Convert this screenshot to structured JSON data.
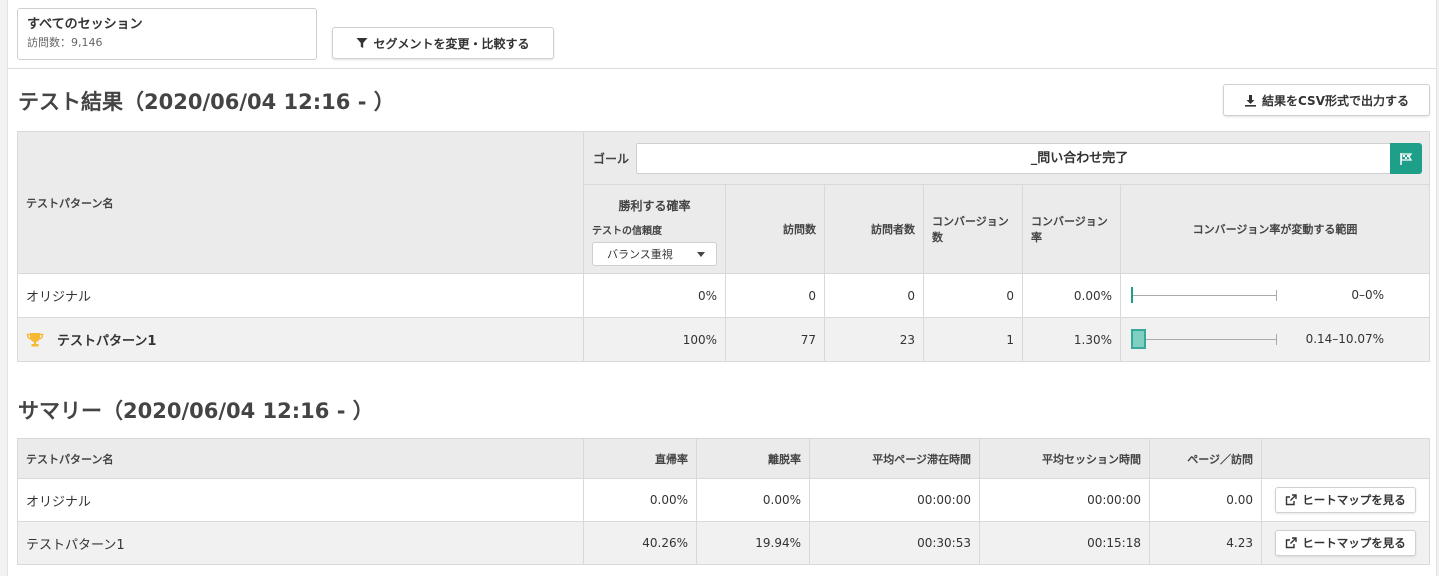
{
  "segment": {
    "title": "すべてのセッション",
    "subtitle": "訪問数：9,146",
    "change_button": "セグメントを変更・比較する"
  },
  "results": {
    "title": "テスト結果（2020/06/04 12:16 - ）",
    "csv_button": "結果をCSV形式で出力する",
    "goal_label": "ゴール",
    "goal_value": "_問い合わせ完了",
    "columns": {
      "pattern_name": "テストパターン名",
      "win_probability": "勝利する確率",
      "confidence_label": "テストの信頼度",
      "confidence_select": "バランス重視",
      "visits": "訪問数",
      "visitors": "訪問者数",
      "conversions": "コンバージョン数",
      "conversion_rate": "コンバージョン率",
      "range": "コンバージョン率が変動する範囲"
    },
    "rows": [
      {
        "name": "オリジナル",
        "win_probability": "0%",
        "visits": "0",
        "visitors": "0",
        "conversions": "0",
        "conversion_rate": "0.00%",
        "range_text": "0–0%",
        "winner": false,
        "range_low": 0,
        "range_high": 0
      },
      {
        "name": "テストパターン1",
        "win_probability": "100%",
        "visits": "77",
        "visitors": "23",
        "conversions": "1",
        "conversion_rate": "1.30%",
        "range_text": "0.14–10.07%",
        "winner": true,
        "range_low": 0.14,
        "range_high": 10.07
      }
    ]
  },
  "summary": {
    "title": "サマリー（2020/06/04 12:16 - ）",
    "columns": {
      "pattern_name": "テストパターン名",
      "bounce_direct": "直帰率",
      "exit_rate": "離脱率",
      "avg_page_time": "平均ページ滞在時間",
      "avg_session_time": "平均セッション時間",
      "pages_per_visit": "ページ／訪問"
    },
    "heatmap_button": "ヒートマップを見る",
    "rows": [
      {
        "name": "オリジナル",
        "bounce_direct": "0.00%",
        "exit_rate": "0.00%",
        "avg_page_time": "00:00:00",
        "avg_session_time": "00:00:00",
        "pages_per_visit": "0.00"
      },
      {
        "name": "テストパターン1",
        "bounce_direct": "40.26%",
        "exit_rate": "19.94%",
        "avg_page_time": "00:30:53",
        "avg_session_time": "00:15:18",
        "pages_per_visit": "4.23"
      }
    ]
  },
  "colors": {
    "accent": "#1e9f8a",
    "range_fill": "#7fcfc3",
    "trophy": "#f5b935"
  }
}
